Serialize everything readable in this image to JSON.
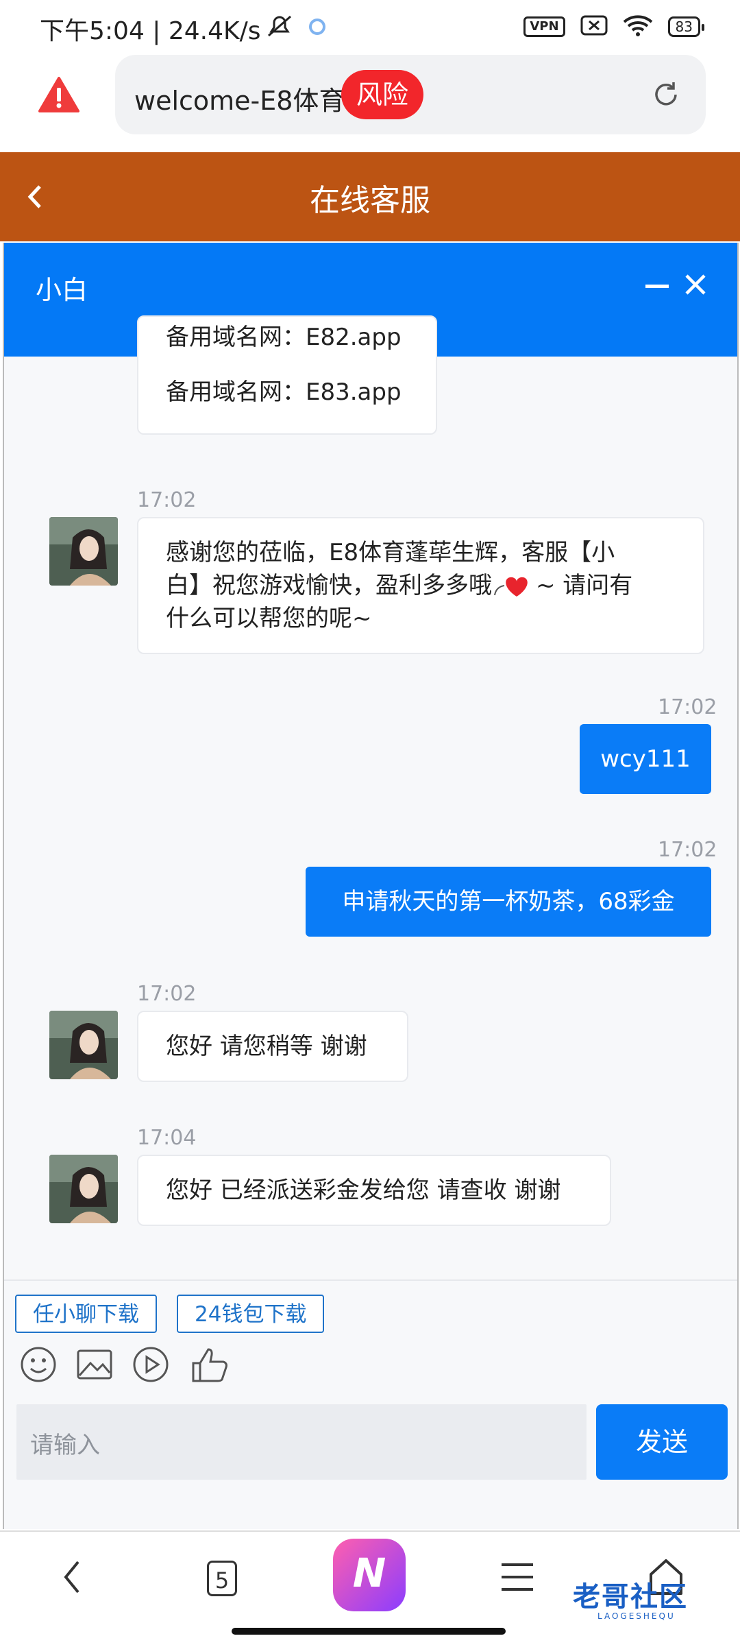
{
  "status_bar": {
    "time_speed": "下午5:04 | 24.4K/s",
    "vpn": "VPN",
    "battery": "83"
  },
  "address_bar": {
    "url_title": "welcome-E8体育",
    "risk_label": "风险"
  },
  "page_header": {
    "title": "在线客服"
  },
  "chat": {
    "agent_name": "小白",
    "partial_message_line": "备用域名网：E82.app",
    "backup_domain": "备用域名网：E83.app",
    "messages": [
      {
        "from": "agent",
        "time": "17:02",
        "text_line1": "感谢您的莅临，E8体育蓬荜生辉，客服【小",
        "text_line2": "白】祝您游戏愉快，盈利多多哦 ",
        "text_line2_tail": " ~ 请问有",
        "text_line3": "什么可以帮您的呢~"
      },
      {
        "from": "me",
        "time": "17:02",
        "text": "wcy111"
      },
      {
        "from": "me",
        "time": "17:02",
        "text": "申请秋天的第一杯奶茶，68彩金"
      },
      {
        "from": "agent",
        "time": "17:02",
        "text": "您好 请您稍等 谢谢"
      },
      {
        "from": "agent",
        "time": "17:04",
        "text": "您好 已经派送彩金发给您 请查收 谢谢"
      }
    ],
    "quick_links": [
      "任小聊下载",
      "24钱包下载"
    ],
    "input_placeholder": "请输入",
    "send_label": "发送"
  },
  "bottom_nav": {
    "tab_count": "5",
    "ai_letter": "N"
  },
  "watermark": {
    "text": "老哥社区",
    "sub": "LAOGESHEQU"
  },
  "colors": {
    "header_brown": "#bc5413",
    "chat_blue": "#0479f6",
    "risk_red": "#f2262b"
  }
}
